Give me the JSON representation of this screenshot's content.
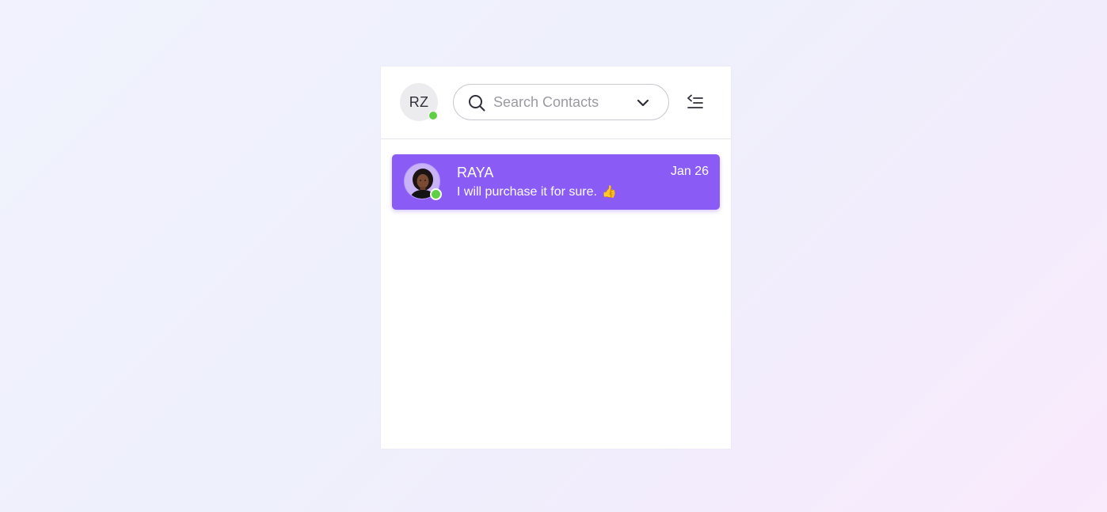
{
  "user": {
    "initials": "RZ",
    "status_color": "#5fcf45"
  },
  "search": {
    "placeholder": "Search Contacts",
    "icon": "search-icon",
    "dropdown_icon": "chevron-down-icon"
  },
  "toolbar": {
    "collapse_icon": "collapse-sidebar-icon"
  },
  "chats": [
    {
      "name": "RAYA",
      "message": "I will purchase it for sure.",
      "emoji": "👍",
      "date": "Jan 26",
      "online": true,
      "selected": true
    }
  ],
  "colors": {
    "accent": "#8a5cf5",
    "online": "#5fcf45"
  }
}
